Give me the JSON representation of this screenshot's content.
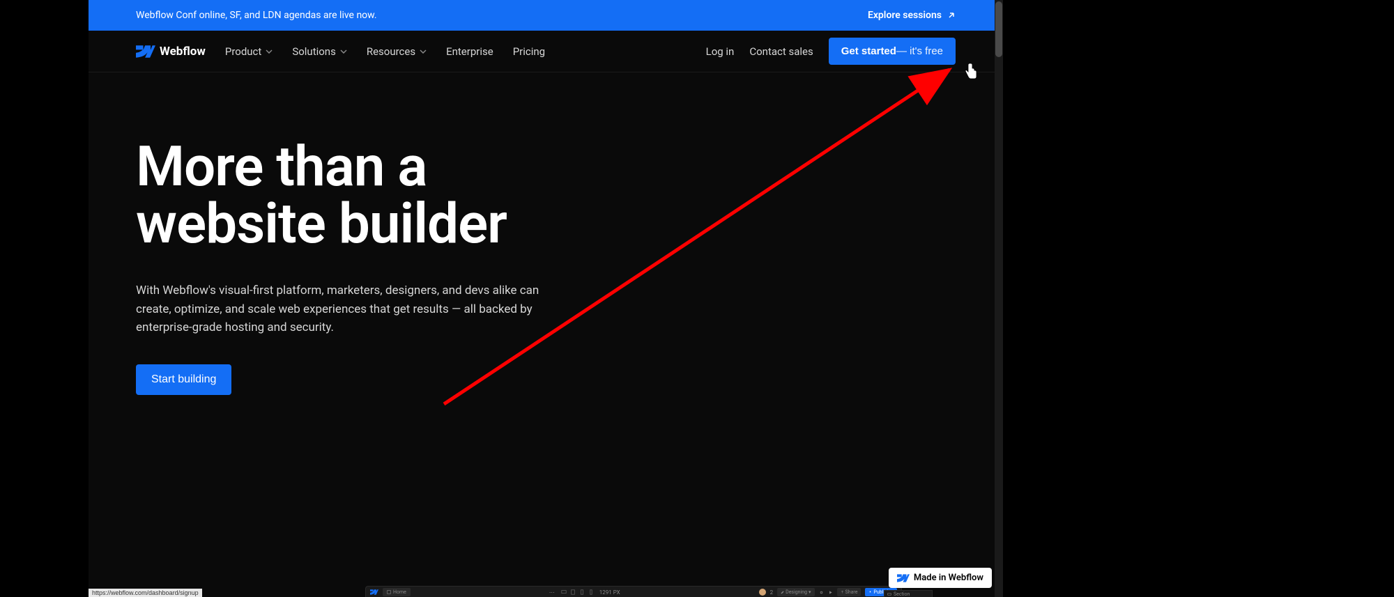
{
  "announcement": {
    "text": "Webflow Conf online, SF, and LDN agendas are live now.",
    "cta": "Explore sessions"
  },
  "nav": {
    "logo_text": "Webflow",
    "items": [
      {
        "label": "Product",
        "has_dropdown": true
      },
      {
        "label": "Solutions",
        "has_dropdown": true
      },
      {
        "label": "Resources",
        "has_dropdown": true
      },
      {
        "label": "Enterprise",
        "has_dropdown": false
      },
      {
        "label": "Pricing",
        "has_dropdown": false
      }
    ],
    "login": "Log in",
    "contact": "Contact sales",
    "cta_bold": "Get started",
    "cta_light": " — it's free"
  },
  "hero": {
    "title_line1": "More than a",
    "title_line2": "website builder",
    "subtitle": "With Webflow's visual-first platform, marketers, designers, and devs alike can create, optimize, and scale web experiences that get results — all backed by enterprise-grade hosting and security.",
    "cta": "Start building"
  },
  "designer": {
    "home": "Home",
    "width": "1291 PX",
    "user_count": "2",
    "designing": "Designing",
    "share": "Share",
    "publish": "Publish",
    "section": "Section"
  },
  "badge": {
    "text": "Made in Webflow"
  },
  "status_url": "https://webflow.com/dashboard/signup"
}
